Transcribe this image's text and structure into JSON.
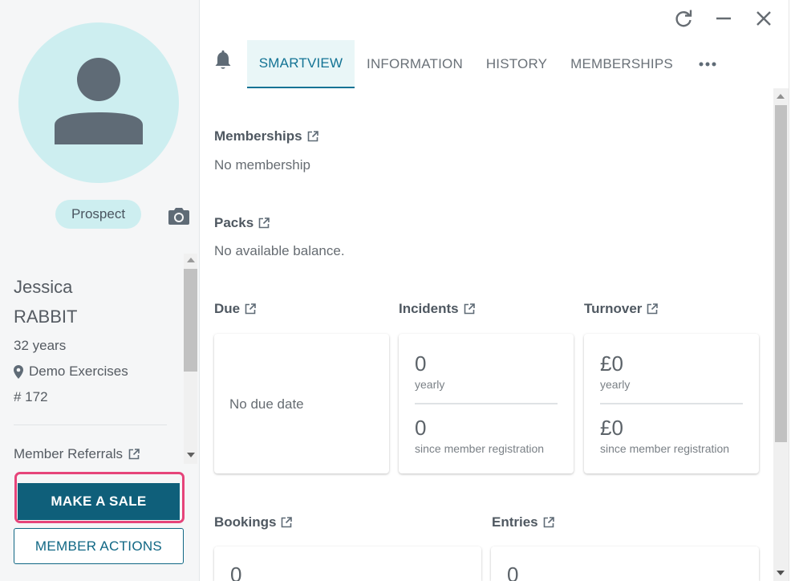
{
  "profile": {
    "status_badge": "Prospect",
    "first_name": "Jessica",
    "last_name": "RABBIT",
    "age": "32 years",
    "location": "Demo Exercises",
    "member_number": "# 172",
    "referrals_label": "Member Referrals",
    "make_sale_label": "MAKE A SALE",
    "member_actions_label": "MEMBER ACTIONS"
  },
  "tabs": [
    {
      "label": "SMARTVIEW",
      "active": true
    },
    {
      "label": "INFORMATION",
      "active": false
    },
    {
      "label": "HISTORY",
      "active": false
    },
    {
      "label": "MEMBERSHIPS",
      "active": false
    }
  ],
  "sections": {
    "memberships": {
      "title": "Memberships",
      "text": "No membership"
    },
    "packs": {
      "title": "Packs",
      "text": "No available balance."
    },
    "due": {
      "title": "Due",
      "text": "No due date"
    },
    "incidents": {
      "title": "Incidents",
      "yearly_value": "0",
      "yearly_label": "yearly",
      "since_value": "0",
      "since_label": "since member registration"
    },
    "turnover": {
      "title": "Turnover",
      "yearly_value": "£0",
      "yearly_label": "yearly",
      "since_value": "£0",
      "since_label": "since member registration"
    },
    "bookings": {
      "title": "Bookings",
      "value": "0"
    },
    "entries": {
      "title": "Entries",
      "value": "0"
    }
  },
  "colors": {
    "accent": "#137394",
    "primary_button": "#0f5f7a",
    "avatar_bg": "#cdeef0",
    "highlight": "#e6447a"
  },
  "icons": [
    "refresh-icon",
    "minimize-icon",
    "close-icon",
    "bell-icon",
    "more-icon",
    "camera-icon",
    "location-pin-icon",
    "external-link-icon",
    "user-icon"
  ]
}
